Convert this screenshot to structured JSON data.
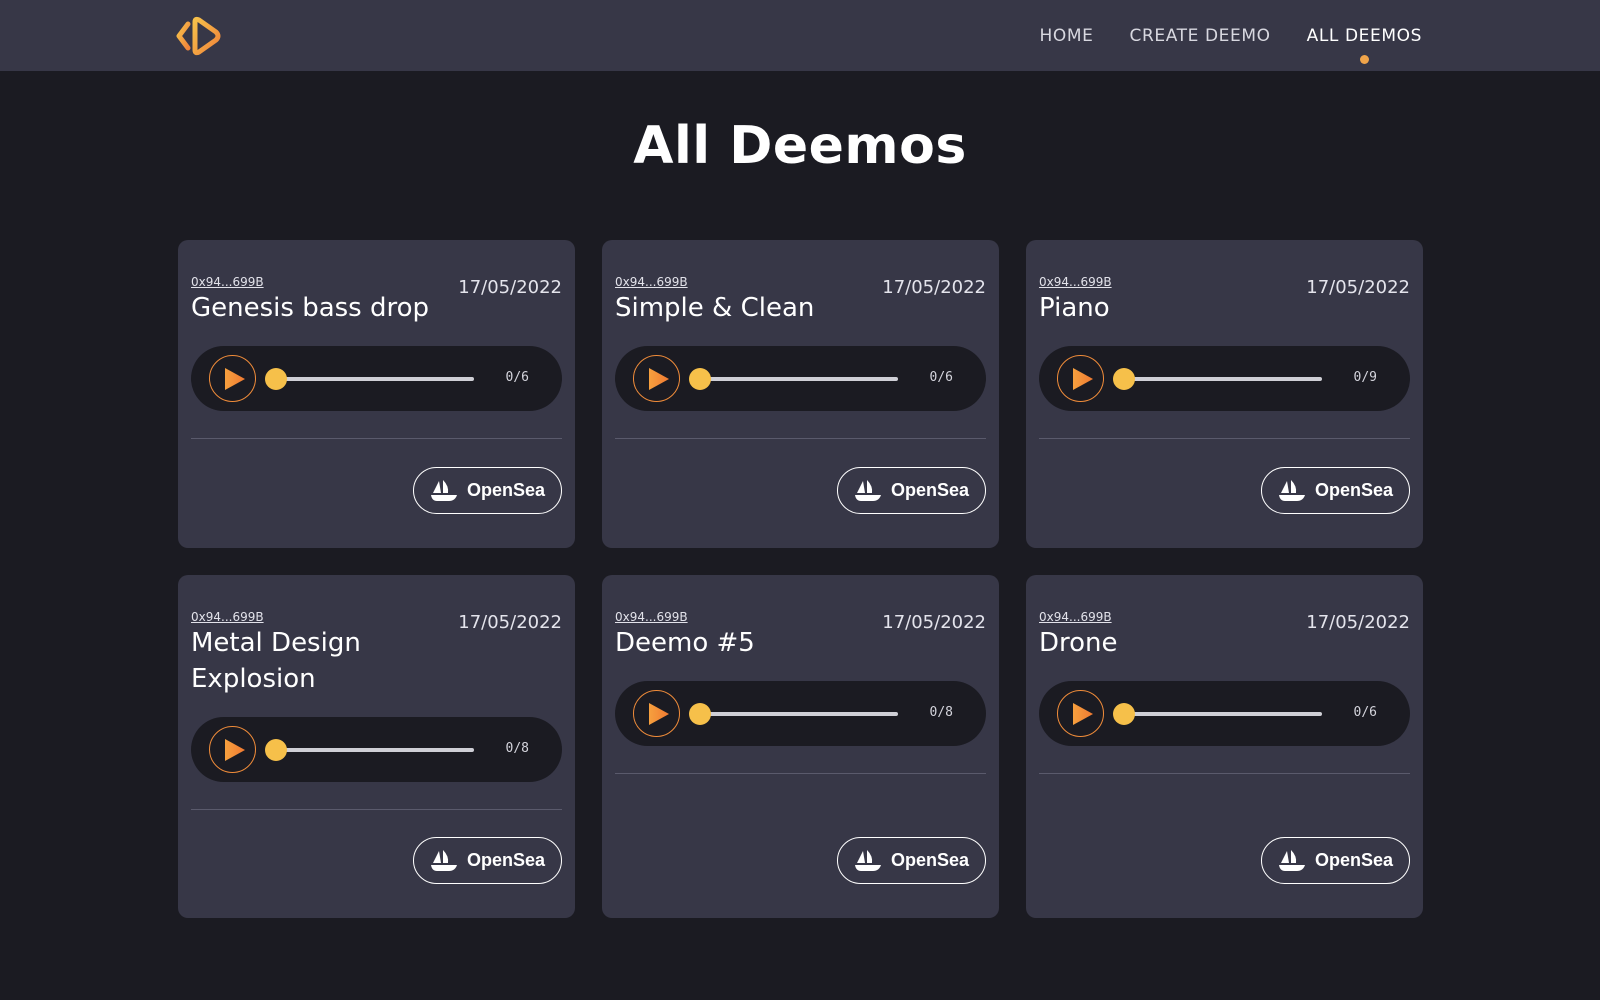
{
  "nav": {
    "logo": "deemo-logo",
    "links": [
      {
        "label": "HOME",
        "active": false
      },
      {
        "label": "CREATE DEEMO",
        "active": false
      },
      {
        "label": "ALL DEEMOS",
        "active": true
      }
    ]
  },
  "page": {
    "title": "All Deemos"
  },
  "colors": {
    "accent": "#f0a44a",
    "play_orange": "#f08c3a",
    "thumb_yellow": "#f6c04a",
    "card_bg": "#373747",
    "page_bg": "#1b1b22"
  },
  "cards": [
    {
      "owner": "0x94...699B",
      "date": "17/05/2022",
      "title": "Genesis bass drop",
      "time": "0/6",
      "progress": 0,
      "button": "OpenSea"
    },
    {
      "owner": "0x94...699B",
      "date": "17/05/2022",
      "title": "Simple & Clean",
      "time": "0/6",
      "progress": 0,
      "button": "OpenSea"
    },
    {
      "owner": "0x94...699B",
      "date": "17/05/2022",
      "title": "Piano",
      "time": "0/9",
      "progress": 0,
      "button": "OpenSea"
    },
    {
      "owner": "0x94...699B",
      "date": "17/05/2022",
      "title": "Metal Design Explosion",
      "time": "0/8",
      "progress": 0,
      "button": "OpenSea"
    },
    {
      "owner": "0x94...699B",
      "date": "17/05/2022",
      "title": "Deemo #5",
      "time": "0/8",
      "progress": 0,
      "button": "OpenSea"
    },
    {
      "owner": "0x94...699B",
      "date": "17/05/2022",
      "title": "Drone",
      "time": "0/6",
      "progress": 0,
      "button": "OpenSea"
    }
  ]
}
